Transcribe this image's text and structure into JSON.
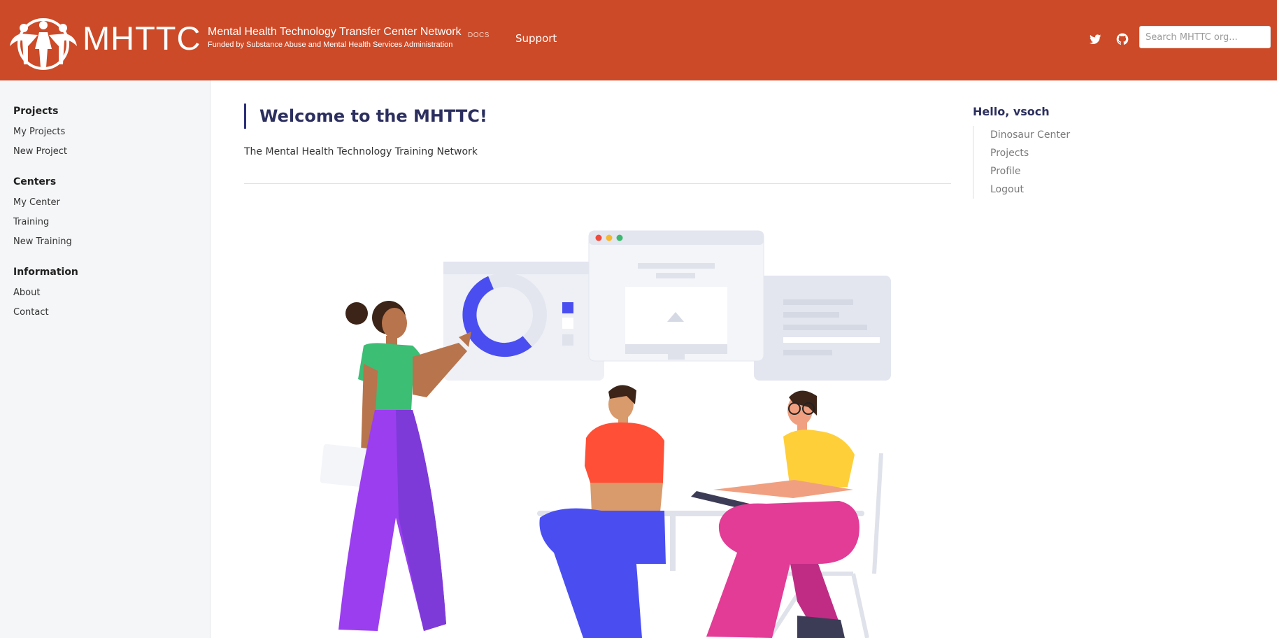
{
  "header": {
    "logo_text": "MHTTC",
    "org_name": "Mental Health Technology Transfer Center Network",
    "docs_label": "DOCS",
    "funded_by": "Funded by Substance Abuse and Mental Health Services Administration",
    "nav": {
      "support_label": "Support"
    },
    "social": [
      "twitter-icon",
      "github-icon"
    ],
    "search": {
      "placeholder": "Search MHTTC org...",
      "value": ""
    },
    "colors": {
      "brand": "#cc4a27"
    }
  },
  "sidebar": {
    "groups": [
      {
        "heading": "Projects",
        "items": [
          "My Projects",
          "New Project"
        ]
      },
      {
        "heading": "Centers",
        "items": [
          "My Center",
          "Training",
          "New Training"
        ]
      },
      {
        "heading": "Information",
        "items": [
          "About",
          "Contact"
        ]
      }
    ]
  },
  "main": {
    "title": "Welcome to the MHTTC!",
    "subtitle": "The Mental Health Technology Training Network"
  },
  "user_panel": {
    "greeting": "Hello, vsoch",
    "items": [
      "Dinosaur Center",
      "Projects",
      "Profile",
      "Logout"
    ]
  }
}
